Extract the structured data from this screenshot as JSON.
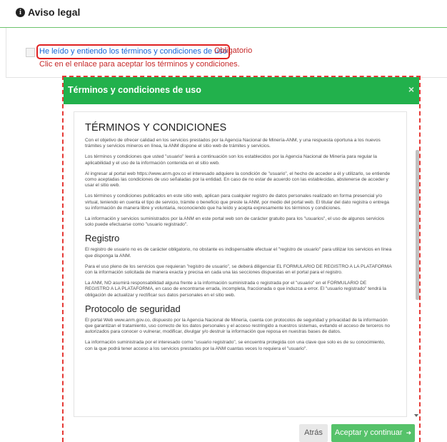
{
  "header": {
    "icon_glyph": "i",
    "title": "Aviso legal"
  },
  "agreement": {
    "link_text": "He leído y entiendo los términos y condiciones de uso",
    "required_label": "Obligatorio",
    "hint": "Clic en el enlace para aceptar los términos y condiciones."
  },
  "modal": {
    "title": "Términos y condiciones de uso",
    "close_glyph": "×",
    "content": {
      "heading_main": "TÉRMINOS Y CONDICIONES",
      "paragraphs_intro": [
        "Con el objetivo de ofrecer calidad en los servicios prestados por la Agencia Nacional de Minería-ANM, y una respuesta oportuna a los nuevos trámites y servicios mineros en línea, la ANM dispone el sitio web de trámites y servicios.",
        "Los términos y condiciones que usted \"usuario\" leerá a continuación son los establecidos por la Agencia Nacional de Minería para regular la aplicabilidad y el uso de la información contenida en el sitio web.",
        "Al ingresar al portal web https://www.anm.gov.co el interesado adquiere la condición de \"usuario\", el hecho de acceder a él y utilizarlo, se entiende como aceptadas las condiciones de uso señaladas por la entidad. En caso de no estar de acuerdo con las establecidas, abstenerse de acceder y usar el sitio web.",
        "Los términos y condiciones publicados en este sitio web, aplican para cualquier registro de datos personales realizado en forma presencial y/o virtual, teniendo en cuenta el tipo de servicio, trámite o beneficio que preste la ANM, por medio del portal web. El titular del dato registra o entrega su información de manera libre y voluntaria, reconociendo que ha leído y acepta expresamente los términos y condiciones.",
        "La información y servicios suministrados por la ANM en este portal web son de carácter gratuito para los \"usuarios\", el uso de algunos servicios solo puede efectuarse como \"usuario registrado\"."
      ],
      "heading_registro": "Registro",
      "paragraphs_registro": [
        "El registro de usuario no es de carácter obligatorio, no obstante es indispensable efectuar el \"registro de usuario\" para utilizar los servicios en línea que disponga la ANM.",
        "Para el uso pleno de los servicios que requieran \"registro de usuario\", se deberá diligenciar EL FORMULARIO DE REGISTRO A LA PLATAFORMA con la información solicitada de manera exacta y precisa en cada una las secciones dispuestas en el portal para el registro.",
        "La ANM, NO asumirá responsabilidad alguna frente a la información suministrada o registrada por el \"usuario\" en el FORMULARIO DE REGISTRO A LA PLATAFORMA, en caso de encontrarse errada, incompleta, fraccionada o que induzca a error. El \"usuario registrado\" tendrá la obligación de actualizar y rectificar sus datos personales en el sitio web."
      ],
      "heading_protocolo": "Protocolo de seguridad",
      "paragraphs_protocolo": [
        "El portal Web www.anm.gov.co, dispuesto por la Agencia Nacional de Minería, cuenta con protocolos de seguridad y privacidad de la información que garantizan el tratamiento, uso correcto de los datos personales y el acceso restringido a nuestros sistemas, evitando el acceso de terceros no autorizados para conocer o vulnerar, modificar, divulgar y/o destruir la información que reposa en nuestras bases de datos.",
        "La información suministrada por el interesado como \"usuario registrado\", se encuentra protegida con una clave que solo es de su conocimiento, con la que podrá tener acceso a los servicios prestados por la ANM cuantas veces lo requiera el \"usuario\"."
      ]
    },
    "footer": {
      "back_label": "Atrás",
      "accept_label": "Aceptar y continuar",
      "accept_arrow": "➜"
    }
  },
  "colors": {
    "header_green": "#22b14c",
    "accept_green": "#56c26a",
    "link_blue": "#1565d8",
    "required_red": "#c62828",
    "highlight_red": "#e02020"
  },
  "icons": [
    "info-icon",
    "close-icon",
    "arrow-right-icon",
    "chevron-down-icon"
  ]
}
